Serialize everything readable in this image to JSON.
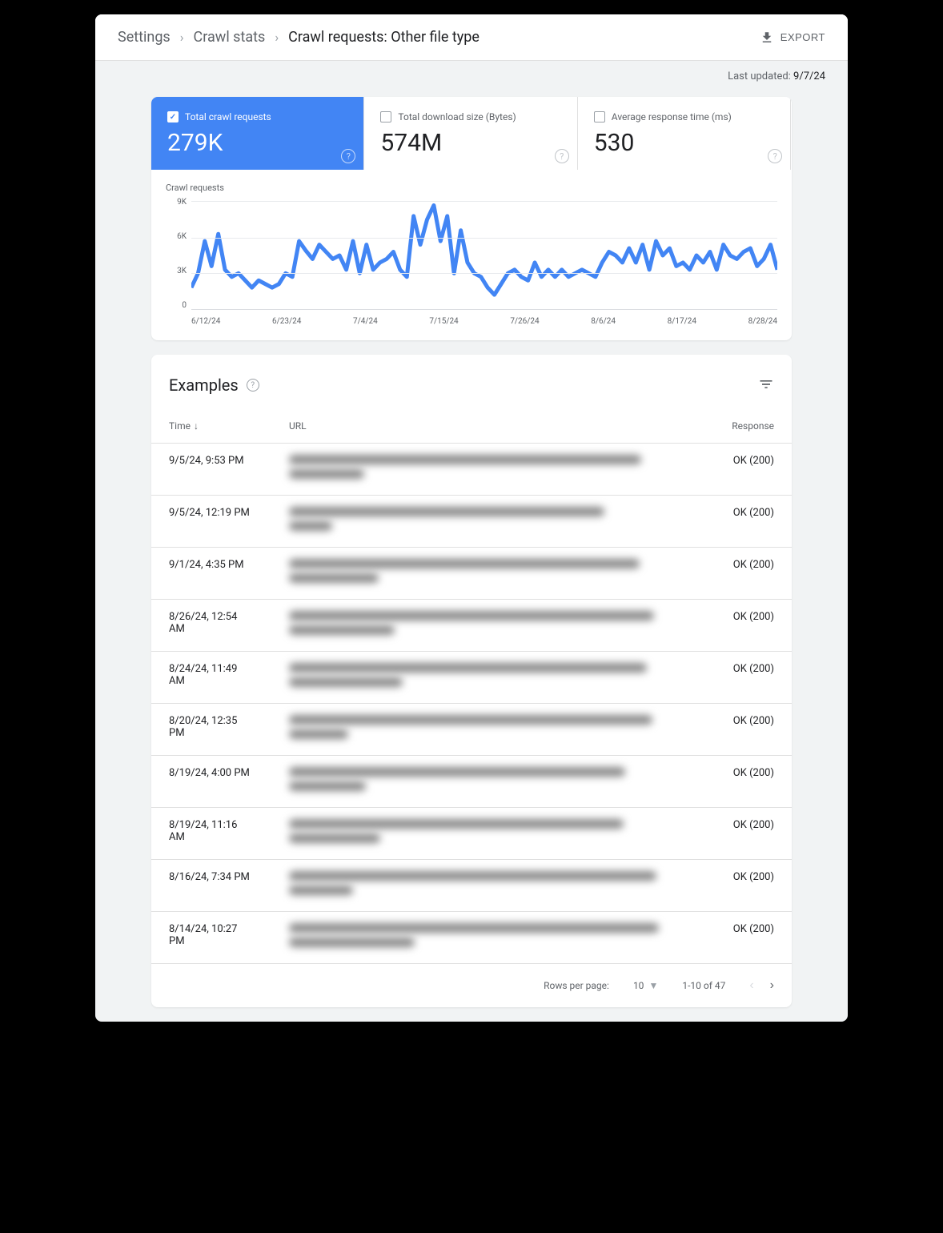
{
  "breadcrumb": {
    "items": [
      "Settings",
      "Crawl stats"
    ],
    "current": "Crawl requests: Other file type"
  },
  "export_label": "EXPORT",
  "last_updated": {
    "label": "Last updated: ",
    "date": "9/7/24"
  },
  "metrics": [
    {
      "label": "Total crawl requests",
      "value": "279K",
      "selected": true
    },
    {
      "label": "Total download size (Bytes)",
      "value": "574M",
      "selected": false
    },
    {
      "label": "Average response time (ms)",
      "value": "530",
      "selected": false
    }
  ],
  "chart_data": {
    "type": "line",
    "title": "Crawl requests",
    "ylabel": "",
    "xlabel": "",
    "ylim": [
      0,
      9000
    ],
    "y_ticks": [
      "9K",
      "6K",
      "3K",
      "0"
    ],
    "x_ticks": [
      "6/12/24",
      "6/23/24",
      "7/4/24",
      "7/15/24",
      "7/26/24",
      "8/6/24",
      "8/17/24",
      "8/28/24"
    ],
    "x": [
      0,
      1,
      2,
      3,
      4,
      5,
      6,
      7,
      8,
      9,
      10,
      11,
      12,
      13,
      14,
      15,
      16,
      17,
      18,
      19,
      20,
      21,
      22,
      23,
      24,
      25,
      26,
      27,
      28,
      29,
      30,
      31,
      32,
      33,
      34,
      35,
      36,
      37,
      38,
      39,
      40,
      41,
      42,
      43,
      44,
      45,
      46,
      47,
      48,
      49,
      50,
      51,
      52,
      53,
      54,
      55,
      56,
      57,
      58,
      59,
      60,
      61,
      62,
      63,
      64,
      65,
      66,
      67,
      68,
      69,
      70,
      71,
      72,
      73,
      74,
      75,
      76,
      77,
      78,
      79,
      80,
      81,
      82,
      83,
      84,
      85,
      86,
      87
    ],
    "values": [
      1800,
      3000,
      5700,
      3600,
      6300,
      3300,
      2700,
      3000,
      2400,
      1800,
      2400,
      2100,
      1800,
      2100,
      3000,
      2700,
      5700,
      4900,
      4200,
      5400,
      4800,
      4200,
      4500,
      3300,
      5700,
      3000,
      5400,
      3300,
      3900,
      4200,
      4800,
      3300,
      2700,
      7800,
      5400,
      7500,
      8700,
      5700,
      7800,
      3000,
      6600,
      3900,
      3000,
      2700,
      1800,
      1200,
      2100,
      3000,
      3300,
      2700,
      2400,
      3900,
      2700,
      3300,
      2700,
      3300,
      2700,
      3000,
      3300,
      3000,
      2700,
      3900,
      4800,
      4500,
      3900,
      5100,
      3900,
      5400,
      3300,
      5700,
      4500,
      5100,
      3600,
      3900,
      3300,
      4500,
      3900,
      4800,
      3300,
      5400,
      4500,
      4200,
      4800,
      5100,
      3600,
      4200,
      5400,
      3300
    ]
  },
  "examples": {
    "title": "Examples",
    "columns": {
      "time": "Time",
      "url": "URL",
      "response": "Response"
    },
    "rows": [
      {
        "time": "9/5/24, 9:53 PM",
        "response": "OK (200)"
      },
      {
        "time": "9/5/24, 12:19 PM",
        "response": "OK (200)"
      },
      {
        "time": "9/1/24, 4:35 PM",
        "response": "OK (200)"
      },
      {
        "time": "8/26/24, 12:54 AM",
        "response": "OK (200)"
      },
      {
        "time": "8/24/24, 11:49 AM",
        "response": "OK (200)"
      },
      {
        "time": "8/20/24, 12:35 PM",
        "response": "OK (200)"
      },
      {
        "time": "8/19/24, 4:00 PM",
        "response": "OK (200)"
      },
      {
        "time": "8/19/24, 11:16 AM",
        "response": "OK (200)"
      },
      {
        "time": "8/16/24, 7:34 PM",
        "response": "OK (200)"
      },
      {
        "time": "8/14/24, 10:27 PM",
        "response": "OK (200)"
      }
    ],
    "pagination": {
      "rows_label": "Rows per page:",
      "rows_value": "10",
      "range": "1-10 of 47"
    }
  }
}
